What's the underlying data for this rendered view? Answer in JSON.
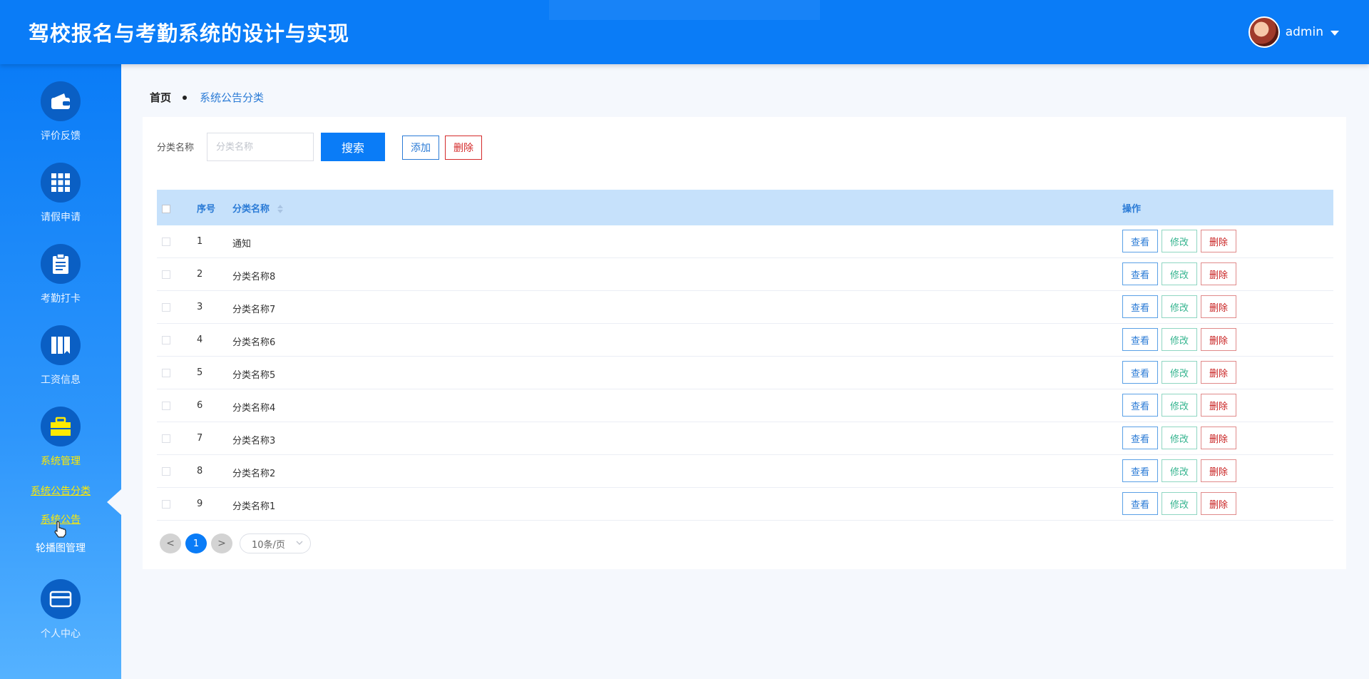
{
  "header": {
    "title": "驾校报名与考勤系统的设计与实现",
    "user_name": "admin"
  },
  "sidebar": {
    "items": [
      {
        "label": "评价反馈",
        "icon": "wallet-icon"
      },
      {
        "label": "请假申请",
        "icon": "grid-icon"
      },
      {
        "label": "考勤打卡",
        "icon": "clipboard-icon"
      },
      {
        "label": "工资信息",
        "icon": "book-icon"
      },
      {
        "label": "系统管理",
        "icon": "briefcase-icon",
        "active": true
      },
      {
        "label": "个人中心",
        "icon": "card-icon"
      }
    ],
    "sub_items": [
      {
        "label": "系统公告分类",
        "highlight": true
      },
      {
        "label": "系统公告",
        "highlight": true
      },
      {
        "label": "轮播图管理",
        "highlight": false
      }
    ]
  },
  "breadcrumb": {
    "home": "首页",
    "current": "系统公告分类"
  },
  "search": {
    "label": "分类名称",
    "placeholder": "分类名称",
    "search_button": "搜索",
    "add_button": "添加",
    "delete_button": "删除"
  },
  "table": {
    "columns": {
      "index": "序号",
      "name": "分类名称",
      "actions": "操作"
    },
    "rows": [
      {
        "index": "1",
        "name": "通知"
      },
      {
        "index": "2",
        "name": "分类名称8"
      },
      {
        "index": "3",
        "name": "分类名称7"
      },
      {
        "index": "4",
        "name": "分类名称6"
      },
      {
        "index": "5",
        "name": "分类名称5"
      },
      {
        "index": "6",
        "name": "分类名称4"
      },
      {
        "index": "7",
        "name": "分类名称3"
      },
      {
        "index": "8",
        "name": "分类名称2"
      },
      {
        "index": "9",
        "name": "分类名称1"
      }
    ],
    "row_actions": {
      "view": "查看",
      "edit": "修改",
      "delete": "删除"
    }
  },
  "pagination": {
    "prev": "<",
    "current_page": "1",
    "next": ">",
    "page_size": "10条/页"
  },
  "colors": {
    "primary": "#0a7cf7",
    "active_menu": "#ffea00",
    "table_header": "#c6e1fb"
  }
}
